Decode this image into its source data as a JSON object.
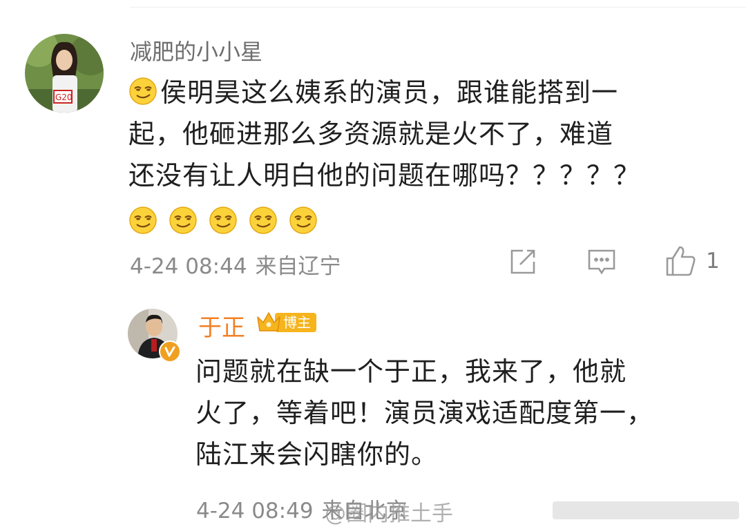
{
  "comment": {
    "username": "减肥的小小星",
    "avatar": "user-avatar-photo",
    "emoji": "smirk-face-emoji",
    "text_lines": [
      "侯明昊这么姨系的演员，跟谁能搭到一",
      "起，他砸进那么多资源就是火不了，难道",
      "还没有让人明白他的问题在哪吗？？？？？"
    ],
    "emoji_count_trailing": 5,
    "date": "4-24 08:44",
    "location": "来自辽宁",
    "like_count": "1",
    "icons": {
      "share": "share-icon",
      "comment": "comment-icon",
      "like": "thumbs-up-icon"
    }
  },
  "reply": {
    "username": "于正",
    "badge_label": "博主",
    "text_lines": [
      "问题就在缺一个于正，我来了，他就",
      "火了，等着吧！演员演戏适配度第一，",
      "陆江来会闪瞎你的。"
    ],
    "date": "4-24 08:49",
    "location": "来自北京",
    "watermark": "@圈内推土手"
  },
  "colors": {
    "name_gray": "#6d6d6d",
    "host_name": "#f28024",
    "badge": "#f6b41d",
    "meta": "#8a8a8a"
  }
}
